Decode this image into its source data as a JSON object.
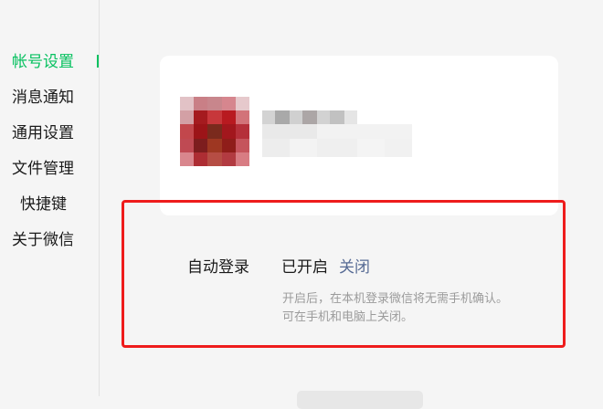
{
  "sidebar": {
    "items": [
      {
        "label": "帐号设置",
        "active": true
      },
      {
        "label": "消息通知",
        "active": false
      },
      {
        "label": "通用设置",
        "active": false
      },
      {
        "label": "文件管理",
        "active": false
      },
      {
        "label": "快捷键",
        "active": false
      },
      {
        "label": "关于微信",
        "active": false
      }
    ]
  },
  "account": {
    "avatar_colors": [
      "#e2c2c6",
      "#c97f86",
      "#c8868c",
      "#d6868e",
      "#e6c9cc",
      "#d3a0a5",
      "#a51b1f",
      "#c7373b",
      "#b81a20",
      "#d27379",
      "#c2474c",
      "#9c1418",
      "#7a2a1d",
      "#a2171d",
      "#b5303a",
      "#bf4a53",
      "#7d1d1e",
      "#9e3722",
      "#8f1d19",
      "#c5545c",
      "#d9868d",
      "#ad2d33",
      "#b64d44",
      "#b23b41",
      "#d87c83"
    ]
  },
  "auto_login": {
    "label": "自动登录",
    "status": "已开启",
    "action": "关闭",
    "hint_line1": "开启后，在本机登录微信将无需手机确认。",
    "hint_line2": "可在手机和电脑上关闭。"
  },
  "colors": {
    "accent_green": "#07c160",
    "link_blue": "#576b95",
    "highlight_red": "#ee1c1c"
  }
}
